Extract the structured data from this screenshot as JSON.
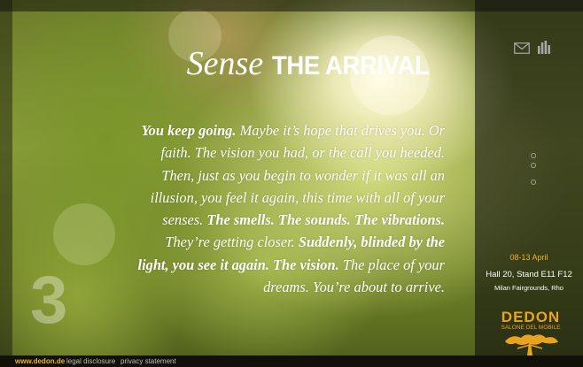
{
  "headline": {
    "sense": "Sense",
    "title": "THE ARRIVAL"
  },
  "story": {
    "segments": [
      {
        "text": "You keep going.",
        "bold": true
      },
      {
        "text": " Maybe it’s hope that drives you. Or faith. The vision you had, or the call you heeded. Then, just as you begin to wonder if it was all an illusion, you feel it again, this time with all of your senses. ",
        "bold": false
      },
      {
        "text": "The smells. The sounds. The vibrations.",
        "bold": true
      },
      {
        "text": " They’re getting closer. ",
        "bold": false
      },
      {
        "text": "Suddenly, blinded by the light, you see it again. The vision.",
        "bold": true
      },
      {
        "text": " The place of your dreams. You’re about to arrive.",
        "bold": false
      }
    ]
  },
  "chapter_number": "3",
  "sidebar": {
    "icons": [
      "mail-icon",
      "chart-icon"
    ],
    "dots_count": 3
  },
  "event": {
    "dates": "08-13 April",
    "hall": "Hall 20, Stand E11 F12",
    "venue": "Milan Fairgrounds, Rho"
  },
  "logo": {
    "brand": "DEDON",
    "sub": "SALONE DEL MOBILE"
  },
  "footer": {
    "site": "www.dedon.de",
    "legal": "legal disclosure",
    "privacy": "privacy statement"
  },
  "colors": {
    "accent": "#f0b323",
    "text": "#ffffff",
    "sidebar": "#12120e"
  }
}
